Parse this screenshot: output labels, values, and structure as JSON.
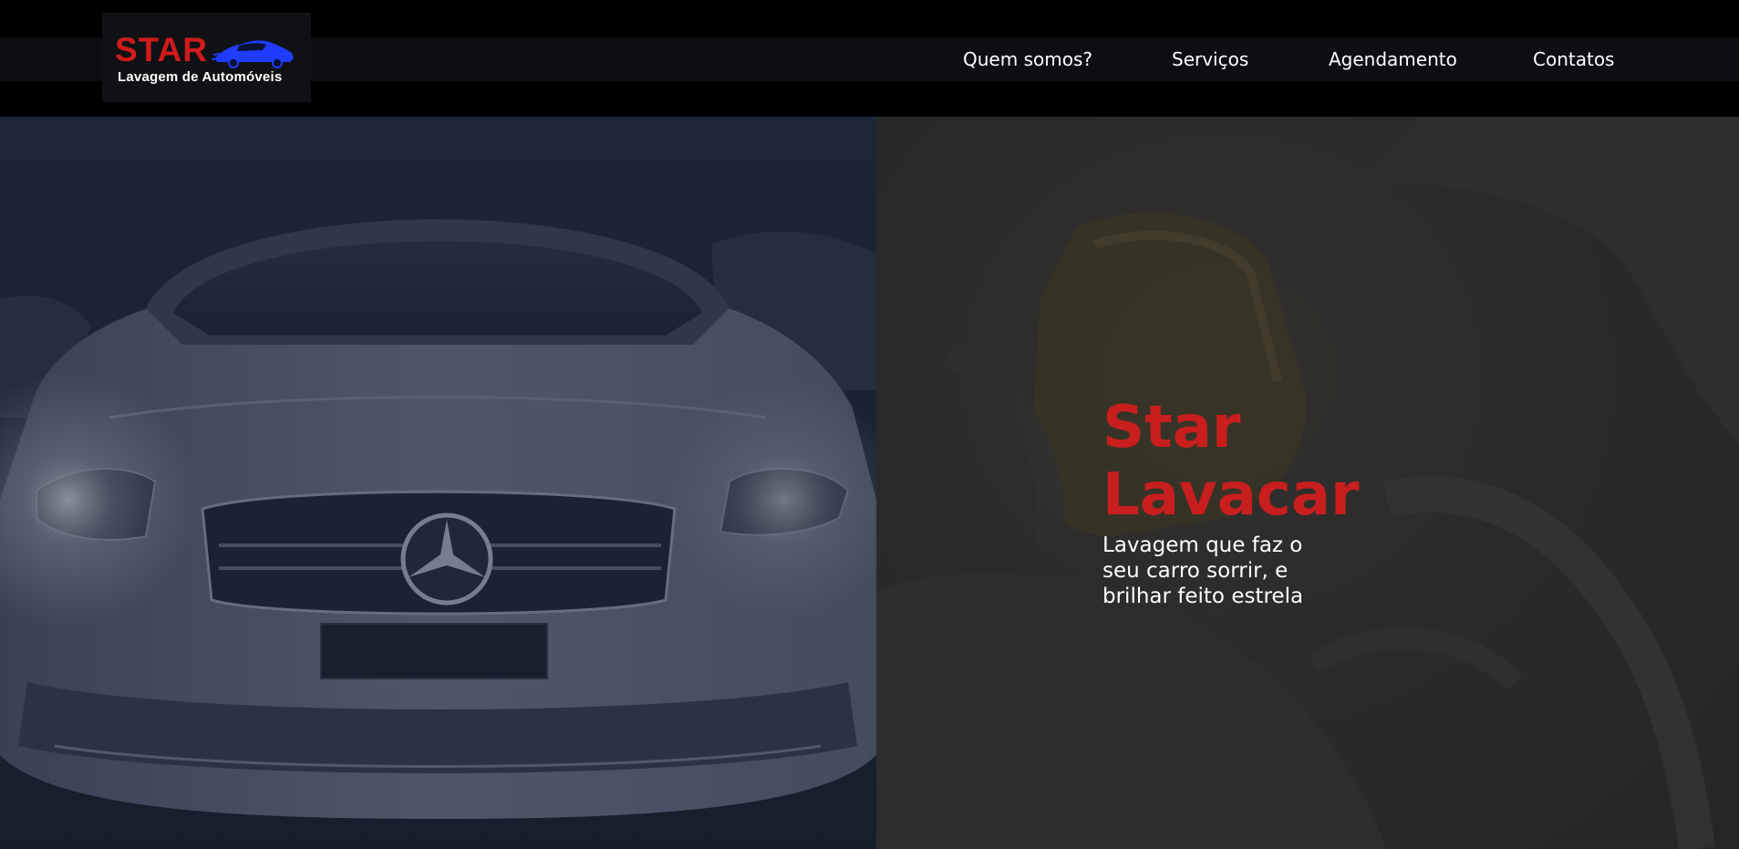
{
  "header": {
    "logo": {
      "title": "STAR",
      "subtitle": "Lavagem de Automóveis",
      "icon": "car-icon",
      "title_color": "#d11a1a",
      "icon_color": "#1f3cff"
    },
    "nav": [
      {
        "label": "Quem somos?"
      },
      {
        "label": "Serviços"
      },
      {
        "label": "Agendamento"
      },
      {
        "label": "Contatos"
      }
    ]
  },
  "hero": {
    "image_left": "car-front-image",
    "image_right": "washing-sponge-image",
    "title_line1": "Star",
    "title_line2": "Lavacar",
    "subtitle": "Lavagem que faz o seu carro sorrir, e brilhar feito estrela",
    "accent_color": "#c81e1e"
  }
}
